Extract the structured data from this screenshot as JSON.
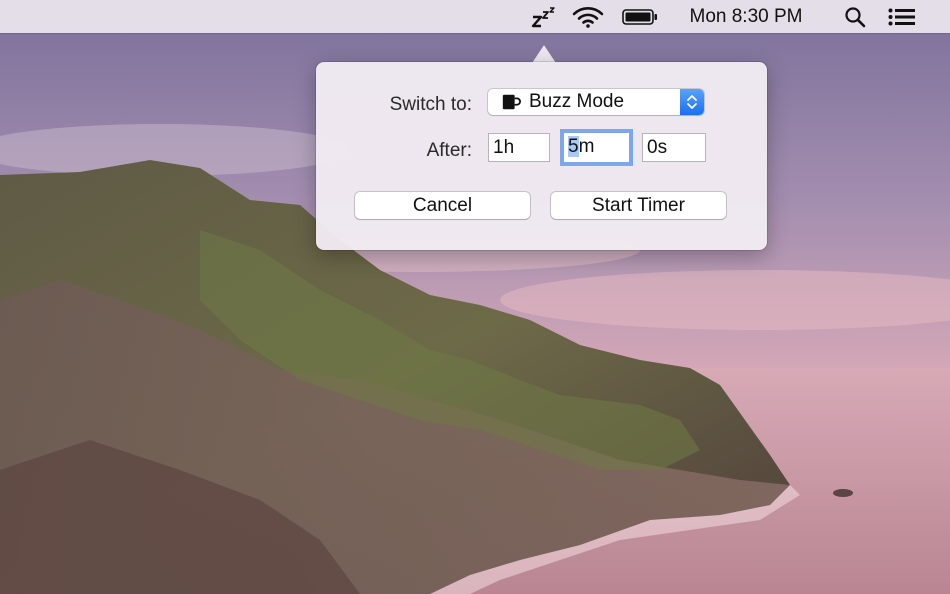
{
  "menubar": {
    "clock": "Mon 8:30 PM",
    "icons": [
      "sleep-zzz-icon",
      "wifi-icon",
      "battery-icon",
      "spotlight-search-icon",
      "notification-center-icon"
    ]
  },
  "popover": {
    "switch_to_label": "Switch to:",
    "mode_select": {
      "selected": "Buzz Mode",
      "icon": "coffee-mug-icon"
    },
    "after_label": "After:",
    "hours_value": "1h",
    "minutes_value": "5m",
    "minutes_selected_char": "5",
    "minutes_rest": "m",
    "seconds_value": "0s",
    "cancel_label": "Cancel",
    "start_label": "Start Timer"
  },
  "colors": {
    "accent": "#1b6ff0",
    "focus_ring": "#5591eb",
    "popover_bg": "#f1eaf2"
  }
}
